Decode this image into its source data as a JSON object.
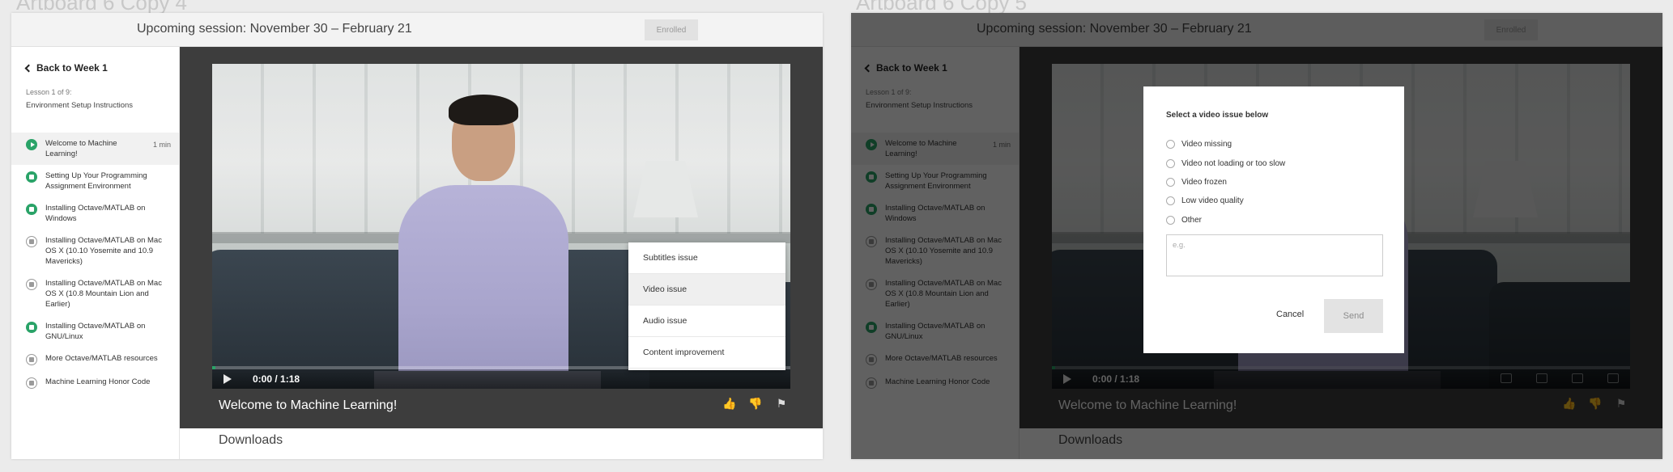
{
  "artboards": [
    {
      "label": "Artboard 6 Copy 4"
    },
    {
      "label": "Artboard 6 Copy 5"
    }
  ],
  "header": {
    "session": "Upcoming session: November 30 – February 21",
    "enrolled": "Enrolled"
  },
  "sidebar": {
    "back": "Back to Week 1",
    "lesson_count": "Lesson 1 of 9:",
    "lesson_name": "Environment Setup Instructions",
    "items": [
      {
        "label": "Welcome to Machine Learning!",
        "duration": "1 min",
        "icon": "play-icon",
        "active": true
      },
      {
        "label": "Setting Up Your Programming Assignment Environment",
        "duration": "",
        "icon": "reading-complete-icon"
      },
      {
        "label": "Installing Octave/MATLAB on Windows",
        "duration": "",
        "icon": "reading-complete-icon"
      },
      {
        "label": "Installing Octave/MATLAB on Mac OS X (10.10 Yosemite and 10.9 Mavericks)",
        "duration": "",
        "icon": "reading-icon"
      },
      {
        "label": "Installing Octave/MATLAB on Mac OS X (10.8 Mountain Lion and Earlier)",
        "duration": "",
        "icon": "reading-icon"
      },
      {
        "label": "Installing Octave/MATLAB on GNU/Linux",
        "duration": "",
        "icon": "reading-complete-icon"
      },
      {
        "label": "More Octave/MATLAB resources",
        "duration": "",
        "icon": "reading-icon"
      },
      {
        "label": "Machine Learning Honor Code",
        "duration": "",
        "icon": "reading-icon"
      }
    ]
  },
  "player": {
    "time": "0:00  /  1:18",
    "progress": 0.005,
    "title": "Welcome to Machine Learning!"
  },
  "issue_menu": {
    "options": [
      "Subtitles issue",
      "Video issue",
      "Audio issue",
      "Content improvement"
    ],
    "selected": 1
  },
  "downloads": "Downloads",
  "modal": {
    "title": "Select a video issue below",
    "options": [
      "Video missing",
      "Video not loading or too slow",
      "Video frozen",
      "Low video quality",
      "Other"
    ],
    "placeholder": "e.g.",
    "cancel": "Cancel",
    "send": "Send"
  },
  "colors": {
    "accent": "#2aa368",
    "stage": "#3d3d3d"
  }
}
